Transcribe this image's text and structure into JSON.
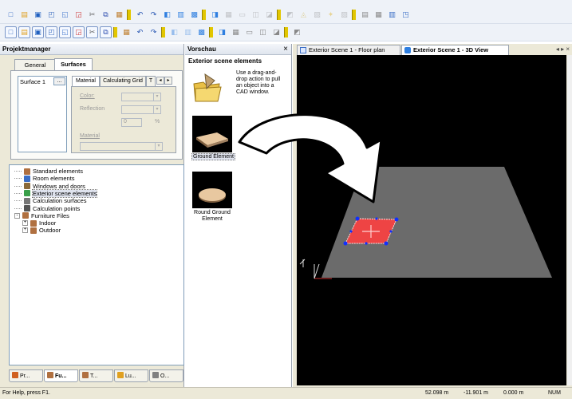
{
  "toolbar": {
    "row1_icons": [
      "new-icon",
      "open-icon",
      "save-icon",
      "print-icon",
      "preview-icon",
      "pdf-icon",
      "cut-icon",
      "copy-icon",
      "paste-icon",
      "undo-icon",
      "redo-icon",
      "layer-icon",
      "floorplan-icon",
      "view3d-icon",
      "render-icon",
      "grid-icon",
      "ruler-icon",
      "snap-icon",
      "dimension-icon",
      "measure-icon",
      "calc-icon",
      "results-icon",
      "light-icon",
      "output-icon",
      "report-icon",
      "table-icon",
      "chart-icon",
      "window-icon"
    ],
    "row2_icons": [
      "select-icon",
      "move-icon",
      "rotate-icon",
      "room-icon",
      "wall-icon",
      "door-icon",
      "window-tool-icon",
      "object-icon",
      "luminaire-icon",
      "zoom-icon",
      "pan-icon",
      "orbit-icon",
      "camera-icon",
      "color-icon",
      "material-icon",
      "surface-icon",
      "scene-icon",
      "light-scene-icon",
      "daylight-icon",
      "export-icon"
    ]
  },
  "left_panel": {
    "title": "Projektmanager",
    "tabs": [
      "General",
      "Surfaces"
    ],
    "active_tab": "Surfaces",
    "surface_list": [
      "Surface 1"
    ],
    "surface_button": "...",
    "subtabs": [
      "Material",
      "Calculating Grid",
      "T"
    ],
    "color_label": "Color:",
    "reflection_label": "Reflection",
    "reflection_value": "0",
    "material_label": "Material",
    "tree": [
      {
        "label": "Standard elements",
        "icon_color": "#b07040",
        "indent": 0,
        "expander": ""
      },
      {
        "label": "Room elements",
        "icon_color": "#3a6ec6",
        "indent": 0,
        "expander": ""
      },
      {
        "label": "Windows and doors",
        "icon_color": "#8a6a3a",
        "indent": 0,
        "expander": ""
      },
      {
        "label": "Exterior scene elements",
        "icon_color": "#3aa04a",
        "indent": 0,
        "expander": "",
        "selected": true
      },
      {
        "label": "Calculation surfaces",
        "icon_color": "#777777",
        "indent": 0,
        "expander": ""
      },
      {
        "label": "Calculation points",
        "icon_color": "#555555",
        "indent": 0,
        "expander": ""
      },
      {
        "label": "Furniture Files",
        "icon_color": "#b07040",
        "indent": 0,
        "expander": "-"
      },
      {
        "label": "Indoor",
        "icon_color": "#b07040",
        "indent": 1,
        "expander": "+"
      },
      {
        "label": "Outdoor",
        "icon_color": "#b07040",
        "indent": 1,
        "expander": "+"
      }
    ],
    "bottom_tabs": [
      "Pr...",
      "Fu...",
      "T...",
      "Lu...",
      "O..."
    ],
    "bottom_active": "Fu..."
  },
  "mid_panel": {
    "title": "Vorschau",
    "close": "×",
    "heading": "Exterior scene elements",
    "hint": "Use a drag-and-drop action to pull an object into a CAD window.",
    "items": [
      {
        "label": "Ground Element"
      },
      {
        "label": "Round Ground Element"
      }
    ]
  },
  "viewport": {
    "tabs": [
      "Exterior Scene 1 - Floor plan",
      "Exterior Scene 1 - 3D View"
    ],
    "active_tab": "Exterior Scene 1 - 3D View",
    "nav_glyphs": "◂ ▸ ×",
    "plane_color": "#6b6b6b",
    "object_color": "#ee4444",
    "background": "#000000"
  },
  "statusbar": {
    "help": "For Help, press F1.",
    "x": "52.098 m",
    "y": "-11.901 m",
    "z": "0.000 m",
    "mode": "NUM"
  }
}
